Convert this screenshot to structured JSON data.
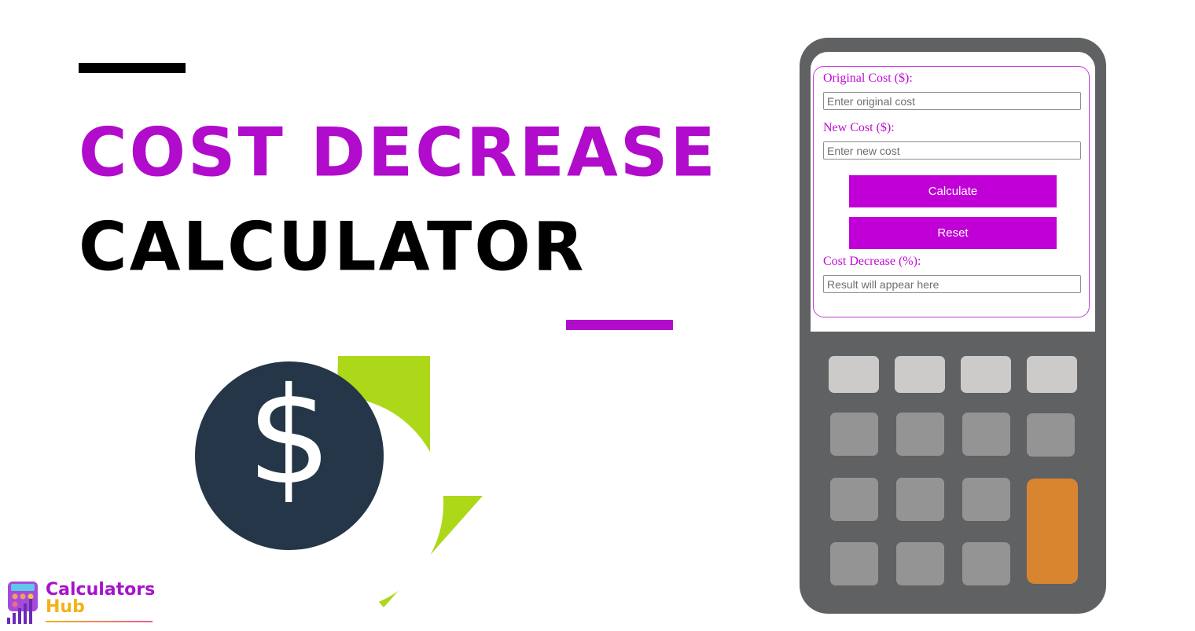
{
  "headline": {
    "line1": "COST DECREASE",
    "line2": "CALCULATOR"
  },
  "colors": {
    "accent_purple": "#b10bcc",
    "button_purple": "#c000d6",
    "label_purple": "#c10bd4",
    "coin_navy": "#243647",
    "arrow_green": "#acd819",
    "device_gray": "#606163",
    "key_light": "#cccbc9",
    "key_mid": "#949494",
    "key_orange": "#d98530"
  },
  "icon": {
    "coin_symbol": "$",
    "name": "dollar-decrease-icon"
  },
  "calculator_form": {
    "original_cost_label": "Original Cost ($):",
    "original_cost_placeholder": "Enter original cost",
    "original_cost_value": "",
    "new_cost_label": "New Cost ($):",
    "new_cost_placeholder": "Enter new cost",
    "new_cost_value": "",
    "calculate_label": "Calculate",
    "reset_label": "Reset",
    "result_label": "Cost Decrease (%):",
    "result_placeholder": "Result will appear here",
    "result_value": ""
  },
  "logo": {
    "line1": "Calculators",
    "line2": "Hub"
  }
}
